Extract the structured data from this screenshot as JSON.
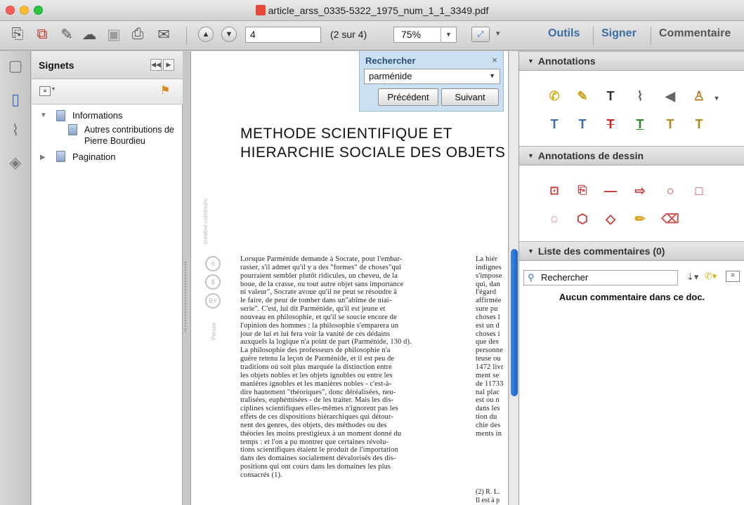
{
  "window": {
    "title": "article_arss_0335-5322_1975_num_1_1_3349.pdf",
    "colors": {
      "close": "#fc5f57",
      "minimize": "#fdbc2f",
      "zoom": "#29c840",
      "accent": "#3a6ea5",
      "scroll_thumb": "#2a72d3"
    }
  },
  "toolbar": {
    "page_input": "4",
    "page_count": "(2 sur 4)",
    "zoom": "75%",
    "tools_label": "Outils",
    "sign_label": "Signer",
    "comment_label": "Commentaire",
    "icons": [
      "create-pdf-icon",
      "combine-icon",
      "edit-icon",
      "cloud-icon",
      "save-icon",
      "print-icon",
      "email-icon"
    ]
  },
  "bookmarks": {
    "title": "Signets",
    "items": [
      {
        "label": "Informations",
        "expanded": true
      },
      {
        "label": "Autres contributions de Pierre Bourdieu",
        "child": true
      },
      {
        "label": "Pagination",
        "expanded": false
      }
    ]
  },
  "search": {
    "title": "Rechercher",
    "close": "×",
    "query": "parménide",
    "prev": "Précédent",
    "next": "Suivant"
  },
  "document": {
    "title": "METHODE SCIENTIFIQUE ET\nHIERARCHIE SOCIALE DES OBJETS",
    "body": "Lorsque Parménide demande à Socrate, pour l'embar-\nrasser, s'il admet qu'il y a des \"formes\" de choses\"qui\npourraient sembler plutôt ridicules, un cheveu, de la\nboue, de la crasse, ou tout autre objet sans importance\nni valeur\", Socrate avoue qu'il ne peut se résoudre à\nle faire, de peur de tomber dans un\"abîme de niai-\nserie\". C'est, lui dit Parménide, qu'il est jeune et\nnouveau en philosophie, et qu'il se soucie encore de\nl'opinion des hommes : la philosophie s'emparera un\njour de lui et lui fera voir la vanité de ces dédains\nauxquels la logique n'a point de part (Parménide, 130 d).\nLa philosophie des professeurs de philosophie n'a\nguère retenu la leçon de Parménide, et il est peu de\ntraditions où soit plus marquée la distinction entre\nles objets nobles et les objets ignobles ou entre les\nmanières ignobles et les manières nobles - c'est-à-\ndire hautement \"théoriques\", donc déréalisées, neu-\ntralisées, euphémisées - de les traiter. Mais les dis-\nciplines scientifiques elles-mêmes n'ignorent pas les\neffets de ces dispositions hiérarchiques qui détour-\nnent des genres, des objets, des méthodes ou des\nthéories les moins prestigieux à un moment donné du\ntemps : et l'on a pu montrer que certaines révolu-\ntions scientifiques étaient le produit de l'importation\ndans des domaines socialement dévalorisés des dis-\npositions qui ont cours dans les domaines les plus\nconsacrés (1).",
    "column2": "La hiér\nindignes\ns'impose\nqui, dan\nl'égard\naffirmée\nsure pu\nchoses l\nest un d\nchoses i\nque des\npersonne\nteuse ou\n1472 livr\nment se\nde 11733\nnal plac\nest ou n\ndans les\ntion du\nchie des\nments in",
    "footnote": "(2) R. L.\nIl est à p",
    "side_label": "Persée",
    "cc_label": "creative commons"
  },
  "right_panel": {
    "annotations_title": "Annotations",
    "drawing_title": "Annotations de dessin",
    "comments_title": "Liste des commentaires (0)",
    "search_placeholder": "Rechercher",
    "empty_text": "Aucun commentaire dans ce doc.",
    "annotation_labels": [
      "T",
      "T",
      "T",
      "T",
      "T",
      "T",
      "T"
    ]
  }
}
